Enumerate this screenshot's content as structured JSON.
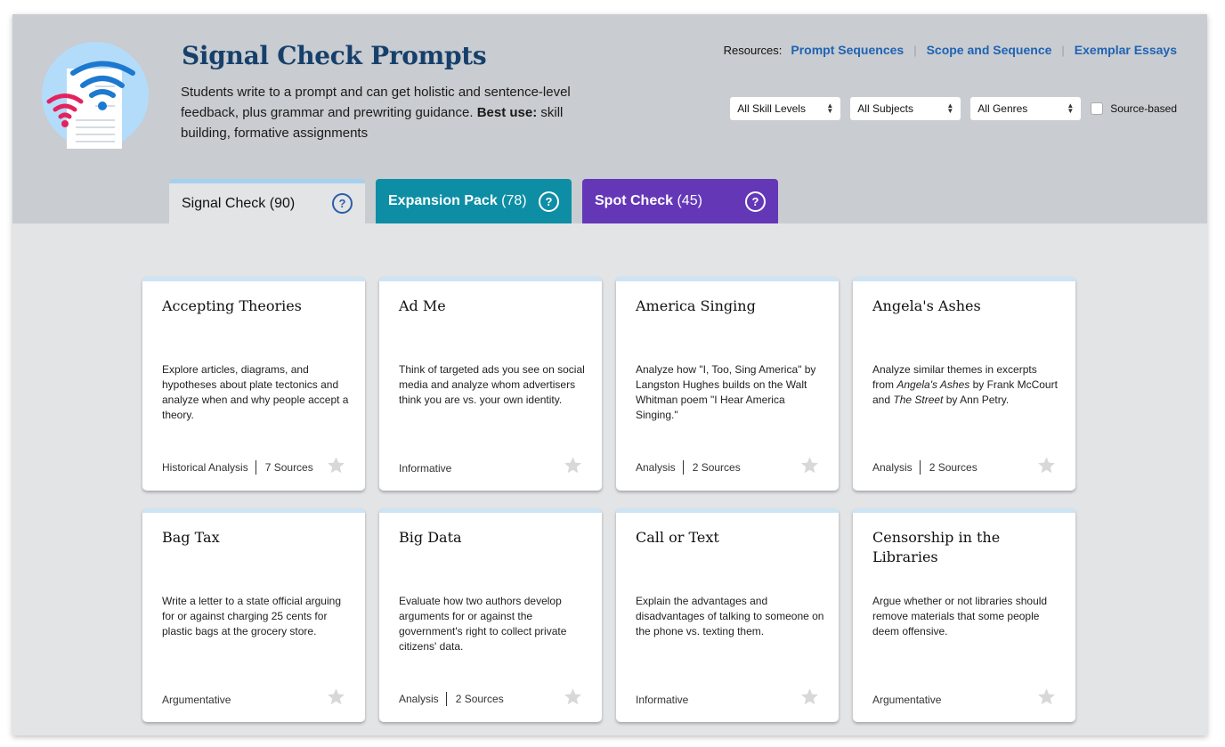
{
  "header": {
    "title": "Signal Check Prompts",
    "description_pre": "Students write to a prompt and can get holistic and sentence-level feedback, plus grammar and prewriting guidance. ",
    "description_bold": "Best use:",
    "description_post": " skill building, formative assignments",
    "logo_icon": "signal-document-icon"
  },
  "resources": {
    "label": "Resources:",
    "links": [
      "Prompt Sequences",
      "Scope and Sequence",
      "Exemplar Essays"
    ],
    "separator": "|"
  },
  "filters": {
    "skill_level": "All Skill Levels",
    "subject": "All Subjects",
    "genre": "All Genres",
    "source_based_label": "Source-based",
    "source_based_checked": false
  },
  "tabs": [
    {
      "name": "Signal Check",
      "count": "(90)",
      "help": "?",
      "active": true,
      "color": "#e3e4e6"
    },
    {
      "name": "Expansion Pack",
      "count": "(78)",
      "help": "?",
      "active": false,
      "color": "#0d8ea5"
    },
    {
      "name": "Spot Check",
      "count": "(45)",
      "help": "?",
      "active": false,
      "color": "#6437b7"
    }
  ],
  "cards": [
    {
      "title": "Accepting Theories",
      "desc": "Explore articles, diagrams, and hypotheses about plate tectonics and analyze when and why people accept a theory.",
      "genre": "Historical Analysis",
      "sources": "7 Sources"
    },
    {
      "title": "Ad Me",
      "desc": "Think of targeted ads you see on social media and analyze whom advertisers think you are vs. your own identity.",
      "genre": "Informative",
      "sources": ""
    },
    {
      "title": "America Singing",
      "desc": "Analyze how \"I, Too, Sing America\" by Langston Hughes builds on the Walt Whitman poem \"I Hear America Singing.\"",
      "genre": "Analysis",
      "sources": "2 Sources"
    },
    {
      "title": "Angela's Ashes",
      "desc_parts": [
        "Analyze similar themes in excerpts from ",
        "Angela's Ashes",
        " by Frank McCourt and ",
        "The Street",
        " by Ann Petry."
      ],
      "genre": "Analysis",
      "sources": "2 Sources"
    },
    {
      "title": "Bag Tax",
      "desc": "Write a letter to a state official arguing for or against charging 25 cents for plastic bags at the grocery store.",
      "genre": "Argumentative",
      "sources": ""
    },
    {
      "title": "Big Data",
      "desc": "Evaluate how two authors develop arguments for or against the government's right to collect private citizens' data.",
      "genre": "Analysis",
      "sources": "2 Sources"
    },
    {
      "title": "Call or Text",
      "desc": "Explain the advantages and disadvantages of talking to someone on the phone vs. texting them.",
      "genre": "Informative",
      "sources": ""
    },
    {
      "title": "Censorship in the Libraries",
      "desc": "Argue whether or not libraries should remove materials that some people deem offensive.",
      "genre": "Argumentative",
      "sources": ""
    }
  ],
  "colors": {
    "header_bg": "#c9ccd0",
    "body_bg": "#e3e4e6",
    "title": "#16406b",
    "link": "#1e63b5",
    "card_accent": "#cde4f5",
    "star": "#d8d8d8"
  }
}
